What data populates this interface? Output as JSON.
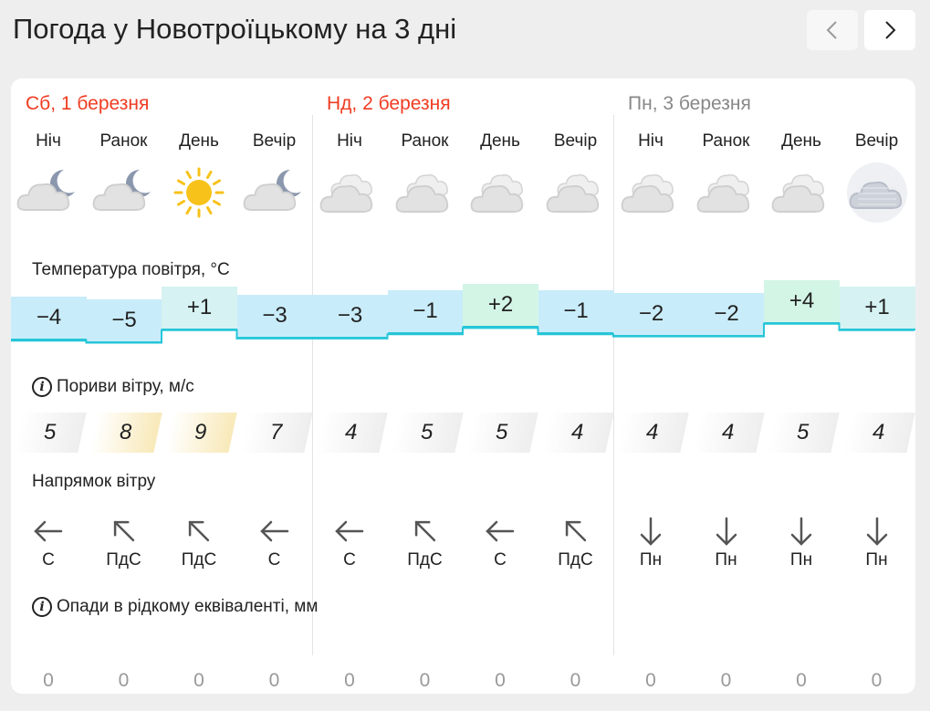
{
  "title": "Погода у Новотроїцькому на 3 дні",
  "nav": {
    "prev_icon": "chevron-left-icon",
    "next_icon": "chevron-right-icon"
  },
  "days": [
    {
      "label": "Сб, 1 березня",
      "color": "#f03c22"
    },
    {
      "label": "Нд, 2 березня",
      "color": "#f03c22"
    },
    {
      "label": "Пн, 3 березня",
      "color": "#888888"
    }
  ],
  "sections": {
    "temperature": "Температура повітря, °C",
    "gusts": "Пориви вітру, м/с",
    "direction": "Напрямок вітру",
    "precip": "Опади в рідкому еквіваленті, мм"
  },
  "periods": [
    {
      "name": "Ніч",
      "icon": "moon-cloud-icon",
      "temp": "−4",
      "gust": "5",
      "dir_arrow": "left",
      "dir": "С",
      "precip": "0"
    },
    {
      "name": "Ранок",
      "icon": "moon-cloud-icon",
      "temp": "−5",
      "gust": "8",
      "dir_arrow": "upleft",
      "dir": "ПдС",
      "precip": "0"
    },
    {
      "name": "День",
      "icon": "sun-icon",
      "temp": "+1",
      "gust": "9",
      "dir_arrow": "upleft",
      "dir": "ПдС",
      "precip": "0"
    },
    {
      "name": "Вечір",
      "icon": "moon-cloud-icon",
      "temp": "−3",
      "gust": "7",
      "dir_arrow": "left",
      "dir": "С",
      "precip": "0"
    },
    {
      "name": "Ніч",
      "icon": "cloud-icon",
      "temp": "−3",
      "gust": "4",
      "dir_arrow": "left",
      "dir": "С",
      "precip": "0"
    },
    {
      "name": "Ранок",
      "icon": "cloud-icon",
      "temp": "−1",
      "gust": "5",
      "dir_arrow": "upleft",
      "dir": "ПдС",
      "precip": "0"
    },
    {
      "name": "День",
      "icon": "cloud-icon",
      "temp": "+2",
      "gust": "5",
      "dir_arrow": "left",
      "dir": "С",
      "precip": "0"
    },
    {
      "name": "Вечір",
      "icon": "cloud-icon",
      "temp": "−1",
      "gust": "4",
      "dir_arrow": "upleft",
      "dir": "ПдС",
      "precip": "0"
    },
    {
      "name": "Ніч",
      "icon": "cloud-icon",
      "temp": "−2",
      "gust": "4",
      "dir_arrow": "down",
      "dir": "Пн",
      "precip": "0"
    },
    {
      "name": "Ранок",
      "icon": "cloud-icon",
      "temp": "−2",
      "gust": "4",
      "dir_arrow": "down",
      "dir": "Пн",
      "precip": "0"
    },
    {
      "name": "День",
      "icon": "cloud-icon",
      "temp": "+4",
      "gust": "5",
      "dir_arrow": "down",
      "dir": "Пн",
      "precip": "0"
    },
    {
      "name": "Вечір",
      "icon": "fog-icon",
      "temp": "+1",
      "gust": "4",
      "dir_arrow": "down",
      "dir": "Пн",
      "precip": "0"
    }
  ],
  "colors": {
    "cold": "#c9ecfa",
    "neutral": "#d6f2f2",
    "warm": "#d3f5e6",
    "gust_warm": "#f8e9b8",
    "gust_plain": "#eeeeee",
    "line": "#26c6d8"
  }
}
